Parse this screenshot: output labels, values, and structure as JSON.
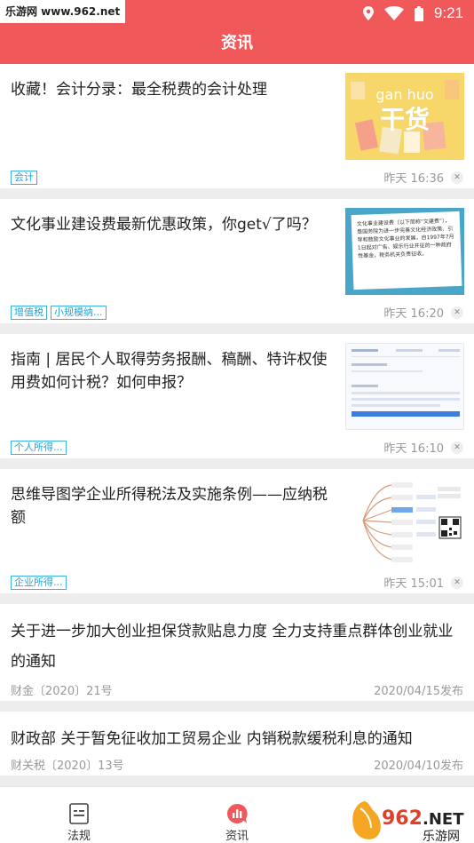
{
  "status_bar": {
    "watermark": "乐游网 www.962.net",
    "time": "9:21"
  },
  "header": {
    "title": "资讯"
  },
  "articles": [
    {
      "title": "收藏！会计分录：最全税费的会计处理",
      "tags": [
        "会计"
      ],
      "time": "昨天 16:36",
      "thumb": {
        "text_top": "gan huo",
        "text_main": "干货"
      }
    },
    {
      "title": "文化事业建设费最新优惠政策，你get√了吗？",
      "tags": [
        "增值税",
        "小规模纳..."
      ],
      "time": "昨天 16:20",
      "thumb": {
        "text": "文化事业建设费（以下简称“文建费”），是国务院为进一步完善文化经济政策、引导和鼓励文化事业的发展，自1997年7月1日起对广告、娱乐行业开征的一种政府性基金，税务机关负责征收。"
      }
    },
    {
      "title": "指南 | 居民个人取得劳务报酬、稿酬、特许权使用费如何计税？如何申报？",
      "tags": [
        "个人所得..."
      ],
      "time": "昨天 16:10"
    },
    {
      "title": "思维导图学企业所得税法及实施条例——应纳税额",
      "tags": [
        "企业所得..."
      ],
      "time": "昨天 15:01"
    }
  ],
  "notices": [
    {
      "title": "关于进一步加大创业担保贷款贴息力度 全力支持重点群体创业就业的通知",
      "source": "财金〔2020〕21号",
      "date": "2020/04/15发布"
    },
    {
      "title": "财政部 关于暂免征收加工贸易企业 内销税款缓税利息的通知",
      "source": "财关税〔2020〕13号",
      "date": "2020/04/10发布"
    }
  ],
  "tabs": [
    {
      "label": "法规",
      "icon": "document-list-icon"
    },
    {
      "label": "资讯",
      "icon": "news-chart-icon",
      "active": true
    }
  ],
  "corner_logo": {
    "brand": "962",
    "tld": ".NET",
    "cn": "乐游网"
  },
  "colors": {
    "brand_red": "#f0585a",
    "tag_blue": "#3bb0e0"
  }
}
